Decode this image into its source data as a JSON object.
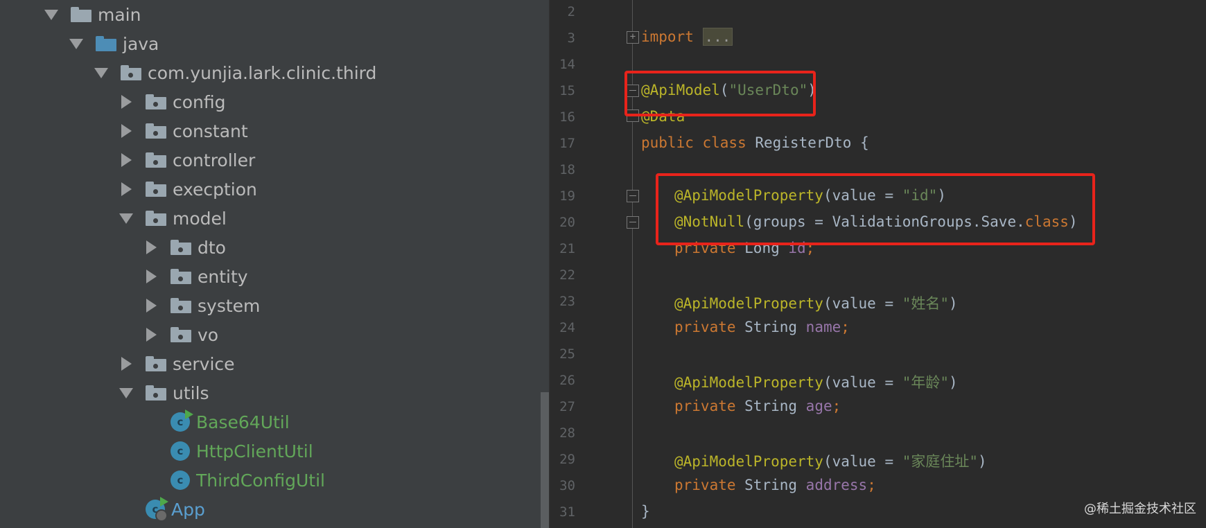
{
  "project_tree": {
    "items": [
      {
        "label": "main",
        "depth": 0,
        "arrow": "open",
        "icon": "folder"
      },
      {
        "label": "java",
        "depth": 1,
        "arrow": "open",
        "icon": "source-folder"
      },
      {
        "label": "com.yunjia.lark.clinic.third",
        "depth": 2,
        "arrow": "open",
        "icon": "package"
      },
      {
        "label": "config",
        "depth": 3,
        "arrow": "closed",
        "icon": "package"
      },
      {
        "label": "constant",
        "depth": 3,
        "arrow": "closed",
        "icon": "package"
      },
      {
        "label": "controller",
        "depth": 3,
        "arrow": "closed",
        "icon": "package"
      },
      {
        "label": "execption",
        "depth": 3,
        "arrow": "closed",
        "icon": "package"
      },
      {
        "label": "model",
        "depth": 3,
        "arrow": "open",
        "icon": "package"
      },
      {
        "label": "dto",
        "depth": 4,
        "arrow": "closed",
        "icon": "package"
      },
      {
        "label": "entity",
        "depth": 4,
        "arrow": "closed",
        "icon": "package"
      },
      {
        "label": "system",
        "depth": 4,
        "arrow": "closed",
        "icon": "package"
      },
      {
        "label": "vo",
        "depth": 4,
        "arrow": "closed",
        "icon": "package"
      },
      {
        "label": "service",
        "depth": 3,
        "arrow": "closed",
        "icon": "package"
      },
      {
        "label": "utils",
        "depth": 3,
        "arrow": "open",
        "icon": "package"
      },
      {
        "label": "Base64Util",
        "depth": 4,
        "arrow": "none",
        "icon": "class-runnable"
      },
      {
        "label": "HttpClientUtil",
        "depth": 4,
        "arrow": "none",
        "icon": "class"
      },
      {
        "label": "ThirdConfigUtil",
        "depth": 4,
        "arrow": "none",
        "icon": "class"
      },
      {
        "label": "App",
        "depth": 3,
        "arrow": "none",
        "icon": "class-app"
      }
    ]
  },
  "editor": {
    "line_numbers": [
      "2",
      "3",
      "14",
      "15",
      "16",
      "17",
      "18",
      "19",
      "20",
      "21",
      "22",
      "23",
      "24",
      "25",
      "26",
      "27",
      "28",
      "29",
      "30",
      "31"
    ],
    "code": {
      "l3_kw": "import",
      "l3_dots": "...",
      "l15_ann": "@ApiModel",
      "l15_open": "(",
      "l15_str": "\"UserDto\"",
      "l15_close": ")",
      "l16_ann": "@Data",
      "l17_kw": "public class",
      "l17_rest": " RegisterDto {",
      "l19_ann": "@ApiModelProperty",
      "l19_mid": "(value = ",
      "l19_str": "\"id\"",
      "l19_close": ")",
      "l20_ann": "@NotNull",
      "l20_mid": "(groups = ValidationGroups.Save.",
      "l20_kw": "class",
      "l20_close": ")",
      "l21_kw": "private",
      "l21_type": " Long ",
      "l21_field": "id",
      "l21_semi": ";",
      "l23_ann": "@ApiModelProperty",
      "l23_mid": "(value = ",
      "l23_str": "\"姓名\"",
      "l23_close": ")",
      "l24_kw": "private",
      "l24_type": " String ",
      "l24_field": "name",
      "l24_semi": ";",
      "l26_ann": "@ApiModelProperty",
      "l26_mid": "(value = ",
      "l26_str": "\"年龄\"",
      "l26_close": ")",
      "l27_kw": "private",
      "l27_type": " String ",
      "l27_field": "age",
      "l27_semi": ";",
      "l29_ann": "@ApiModelProperty",
      "l29_mid": "(value = ",
      "l29_str": "\"家庭住址\"",
      "l29_close": ")",
      "l30_kw": "private",
      "l30_type": " String ",
      "l30_field": "address",
      "l30_semi": ";",
      "l31_brace": "}"
    },
    "highlight_color": "#e8231b"
  },
  "watermark": "@稀土掘金技术社区"
}
